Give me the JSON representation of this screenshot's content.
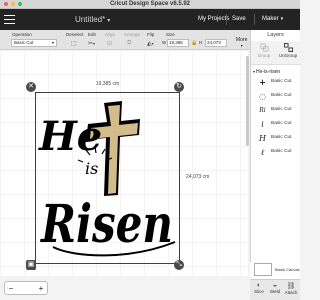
{
  "app": {
    "title": "Cricut Design Space  v6.5.92"
  },
  "header": {
    "project_name": "Untitled*",
    "my_projects": "My Projects",
    "save": "Save",
    "machine": "Maker"
  },
  "toolbar": {
    "operation_label": "Operation",
    "operation_value": "Basic Cut",
    "deselect_label": "Deselect",
    "edit_label": "Edit",
    "align_label": "Align",
    "arrange_label": "Arrange",
    "flip_label": "Flip",
    "size_label": "Size",
    "w_label": "W",
    "w_value": "19,385",
    "h_label": "H",
    "h_value": "24,073",
    "more_label": "More"
  },
  "canvas": {
    "width_dim": "19,385 cm",
    "height_dim": "24,073 cm"
  },
  "design": {
    "word1": "He",
    "word2": "is",
    "word3": "Risen",
    "cross_fill": "#d2bd8a"
  },
  "zoom": {
    "minus": "−",
    "value": "",
    "plus": "+"
  },
  "layers": {
    "title": "Layers",
    "group": "Group",
    "ungroup": "UnGroup",
    "group_name": "He-is-risen",
    "items": [
      {
        "thumb": "+",
        "label": "Basic Cut"
      },
      {
        "thumb": "◌",
        "label": "Basic Cut"
      },
      {
        "thumb": "Ri",
        "label": "Basic Cut"
      },
      {
        "thumb": "i",
        "label": "Basic Cut"
      },
      {
        "thumb": "H",
        "label": "Basic Cut"
      },
      {
        "thumb": "ℓ",
        "label": "Basic Cut"
      }
    ],
    "blank_canvas": "Blank Canvas",
    "bottom": {
      "slice": "Slice",
      "weld": "Weld",
      "attach": "Attach"
    }
  },
  "colors": {
    "header_bg": "#232323",
    "cross": "#d2bd8a",
    "close_dot": "#ff5f57",
    "min_dot": "#febc2e",
    "max_dot": "#28c840"
  }
}
